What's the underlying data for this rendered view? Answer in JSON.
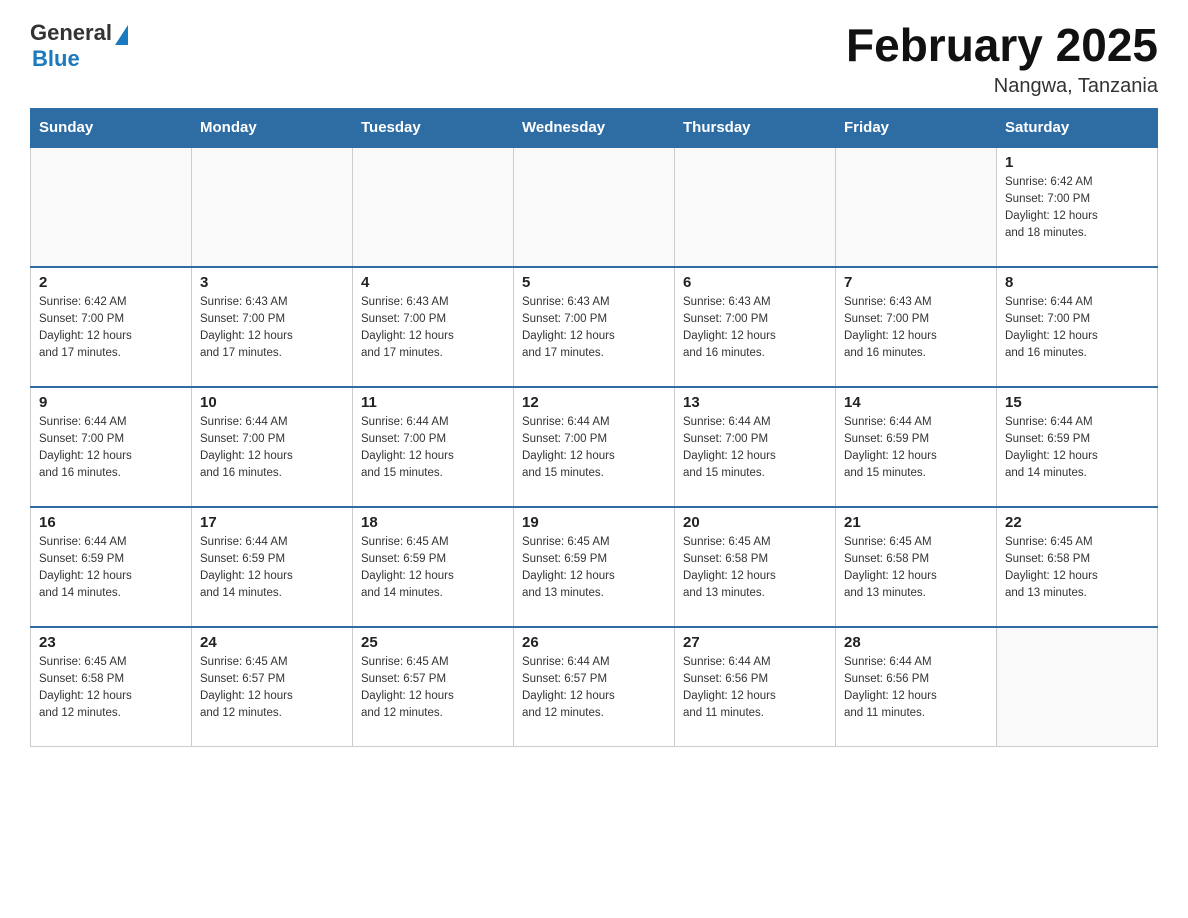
{
  "header": {
    "logo_general": "General",
    "logo_blue": "Blue",
    "month_title": "February 2025",
    "location": "Nangwa, Tanzania"
  },
  "days_of_week": [
    "Sunday",
    "Monday",
    "Tuesday",
    "Wednesday",
    "Thursday",
    "Friday",
    "Saturday"
  ],
  "weeks": [
    {
      "days": [
        {
          "number": "",
          "info": ""
        },
        {
          "number": "",
          "info": ""
        },
        {
          "number": "",
          "info": ""
        },
        {
          "number": "",
          "info": ""
        },
        {
          "number": "",
          "info": ""
        },
        {
          "number": "",
          "info": ""
        },
        {
          "number": "1",
          "info": "Sunrise: 6:42 AM\nSunset: 7:00 PM\nDaylight: 12 hours\nand 18 minutes."
        }
      ]
    },
    {
      "days": [
        {
          "number": "2",
          "info": "Sunrise: 6:42 AM\nSunset: 7:00 PM\nDaylight: 12 hours\nand 17 minutes."
        },
        {
          "number": "3",
          "info": "Sunrise: 6:43 AM\nSunset: 7:00 PM\nDaylight: 12 hours\nand 17 minutes."
        },
        {
          "number": "4",
          "info": "Sunrise: 6:43 AM\nSunset: 7:00 PM\nDaylight: 12 hours\nand 17 minutes."
        },
        {
          "number": "5",
          "info": "Sunrise: 6:43 AM\nSunset: 7:00 PM\nDaylight: 12 hours\nand 17 minutes."
        },
        {
          "number": "6",
          "info": "Sunrise: 6:43 AM\nSunset: 7:00 PM\nDaylight: 12 hours\nand 16 minutes."
        },
        {
          "number": "7",
          "info": "Sunrise: 6:43 AM\nSunset: 7:00 PM\nDaylight: 12 hours\nand 16 minutes."
        },
        {
          "number": "8",
          "info": "Sunrise: 6:44 AM\nSunset: 7:00 PM\nDaylight: 12 hours\nand 16 minutes."
        }
      ]
    },
    {
      "days": [
        {
          "number": "9",
          "info": "Sunrise: 6:44 AM\nSunset: 7:00 PM\nDaylight: 12 hours\nand 16 minutes."
        },
        {
          "number": "10",
          "info": "Sunrise: 6:44 AM\nSunset: 7:00 PM\nDaylight: 12 hours\nand 16 minutes."
        },
        {
          "number": "11",
          "info": "Sunrise: 6:44 AM\nSunset: 7:00 PM\nDaylight: 12 hours\nand 15 minutes."
        },
        {
          "number": "12",
          "info": "Sunrise: 6:44 AM\nSunset: 7:00 PM\nDaylight: 12 hours\nand 15 minutes."
        },
        {
          "number": "13",
          "info": "Sunrise: 6:44 AM\nSunset: 7:00 PM\nDaylight: 12 hours\nand 15 minutes."
        },
        {
          "number": "14",
          "info": "Sunrise: 6:44 AM\nSunset: 6:59 PM\nDaylight: 12 hours\nand 15 minutes."
        },
        {
          "number": "15",
          "info": "Sunrise: 6:44 AM\nSunset: 6:59 PM\nDaylight: 12 hours\nand 14 minutes."
        }
      ]
    },
    {
      "days": [
        {
          "number": "16",
          "info": "Sunrise: 6:44 AM\nSunset: 6:59 PM\nDaylight: 12 hours\nand 14 minutes."
        },
        {
          "number": "17",
          "info": "Sunrise: 6:44 AM\nSunset: 6:59 PM\nDaylight: 12 hours\nand 14 minutes."
        },
        {
          "number": "18",
          "info": "Sunrise: 6:45 AM\nSunset: 6:59 PM\nDaylight: 12 hours\nand 14 minutes."
        },
        {
          "number": "19",
          "info": "Sunrise: 6:45 AM\nSunset: 6:59 PM\nDaylight: 12 hours\nand 13 minutes."
        },
        {
          "number": "20",
          "info": "Sunrise: 6:45 AM\nSunset: 6:58 PM\nDaylight: 12 hours\nand 13 minutes."
        },
        {
          "number": "21",
          "info": "Sunrise: 6:45 AM\nSunset: 6:58 PM\nDaylight: 12 hours\nand 13 minutes."
        },
        {
          "number": "22",
          "info": "Sunrise: 6:45 AM\nSunset: 6:58 PM\nDaylight: 12 hours\nand 13 minutes."
        }
      ]
    },
    {
      "days": [
        {
          "number": "23",
          "info": "Sunrise: 6:45 AM\nSunset: 6:58 PM\nDaylight: 12 hours\nand 12 minutes."
        },
        {
          "number": "24",
          "info": "Sunrise: 6:45 AM\nSunset: 6:57 PM\nDaylight: 12 hours\nand 12 minutes."
        },
        {
          "number": "25",
          "info": "Sunrise: 6:45 AM\nSunset: 6:57 PM\nDaylight: 12 hours\nand 12 minutes."
        },
        {
          "number": "26",
          "info": "Sunrise: 6:44 AM\nSunset: 6:57 PM\nDaylight: 12 hours\nand 12 minutes."
        },
        {
          "number": "27",
          "info": "Sunrise: 6:44 AM\nSunset: 6:56 PM\nDaylight: 12 hours\nand 11 minutes."
        },
        {
          "number": "28",
          "info": "Sunrise: 6:44 AM\nSunset: 6:56 PM\nDaylight: 12 hours\nand 11 minutes."
        },
        {
          "number": "",
          "info": ""
        }
      ]
    }
  ]
}
